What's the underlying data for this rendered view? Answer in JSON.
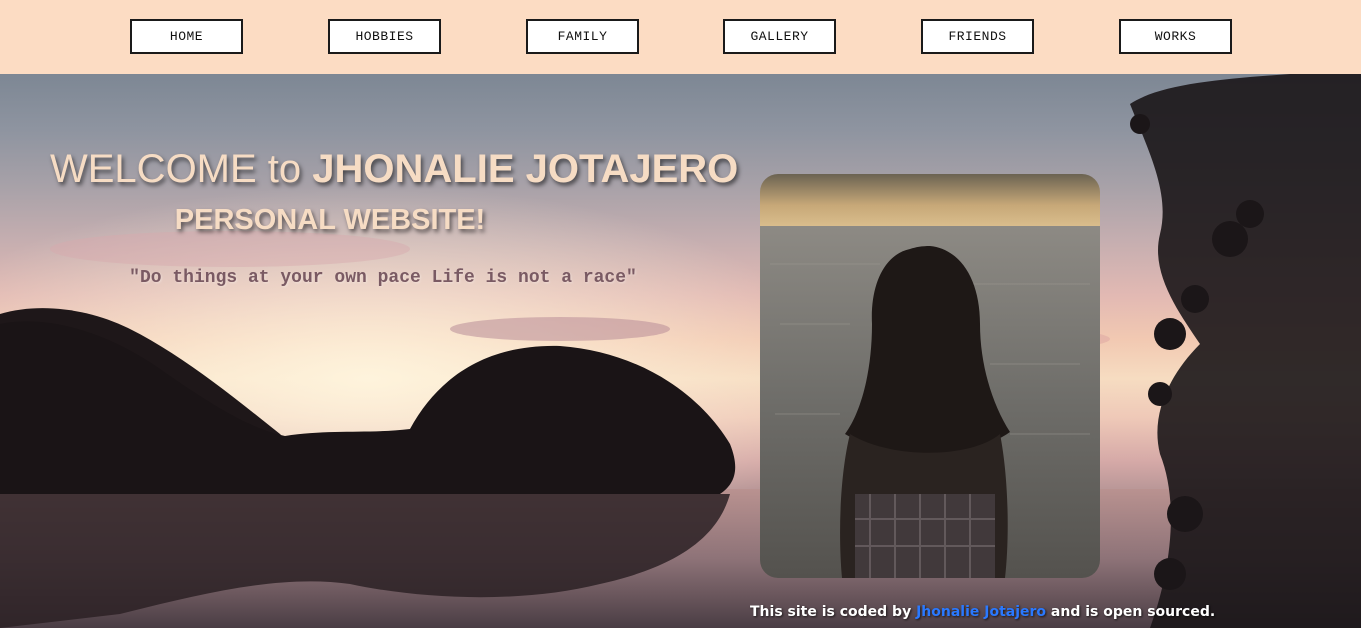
{
  "nav": {
    "home": "HOME",
    "hobbies": "HOBBIES",
    "family": "FAMILY",
    "gallery": "GALLERY",
    "friends": "FRIENDS",
    "works": "WORKS"
  },
  "hero": {
    "welcome_prefix": "WELCOME to",
    "welcome_name": "JHONALIE JOTAJERO",
    "subtitle": "PERSONAL WEBSITE!",
    "quote": "\"Do things at your own pace Life is not a race\""
  },
  "footer": {
    "prefix": "This site is coded by",
    "author_link": "Jhonalie Jotajero",
    "suffix": "and is open sourced."
  },
  "colors": {
    "nav_background": "#fcdcc3",
    "heading_text": "#f6dcc4",
    "quote_text": "#7a5a63",
    "link": "#2a79ff"
  }
}
